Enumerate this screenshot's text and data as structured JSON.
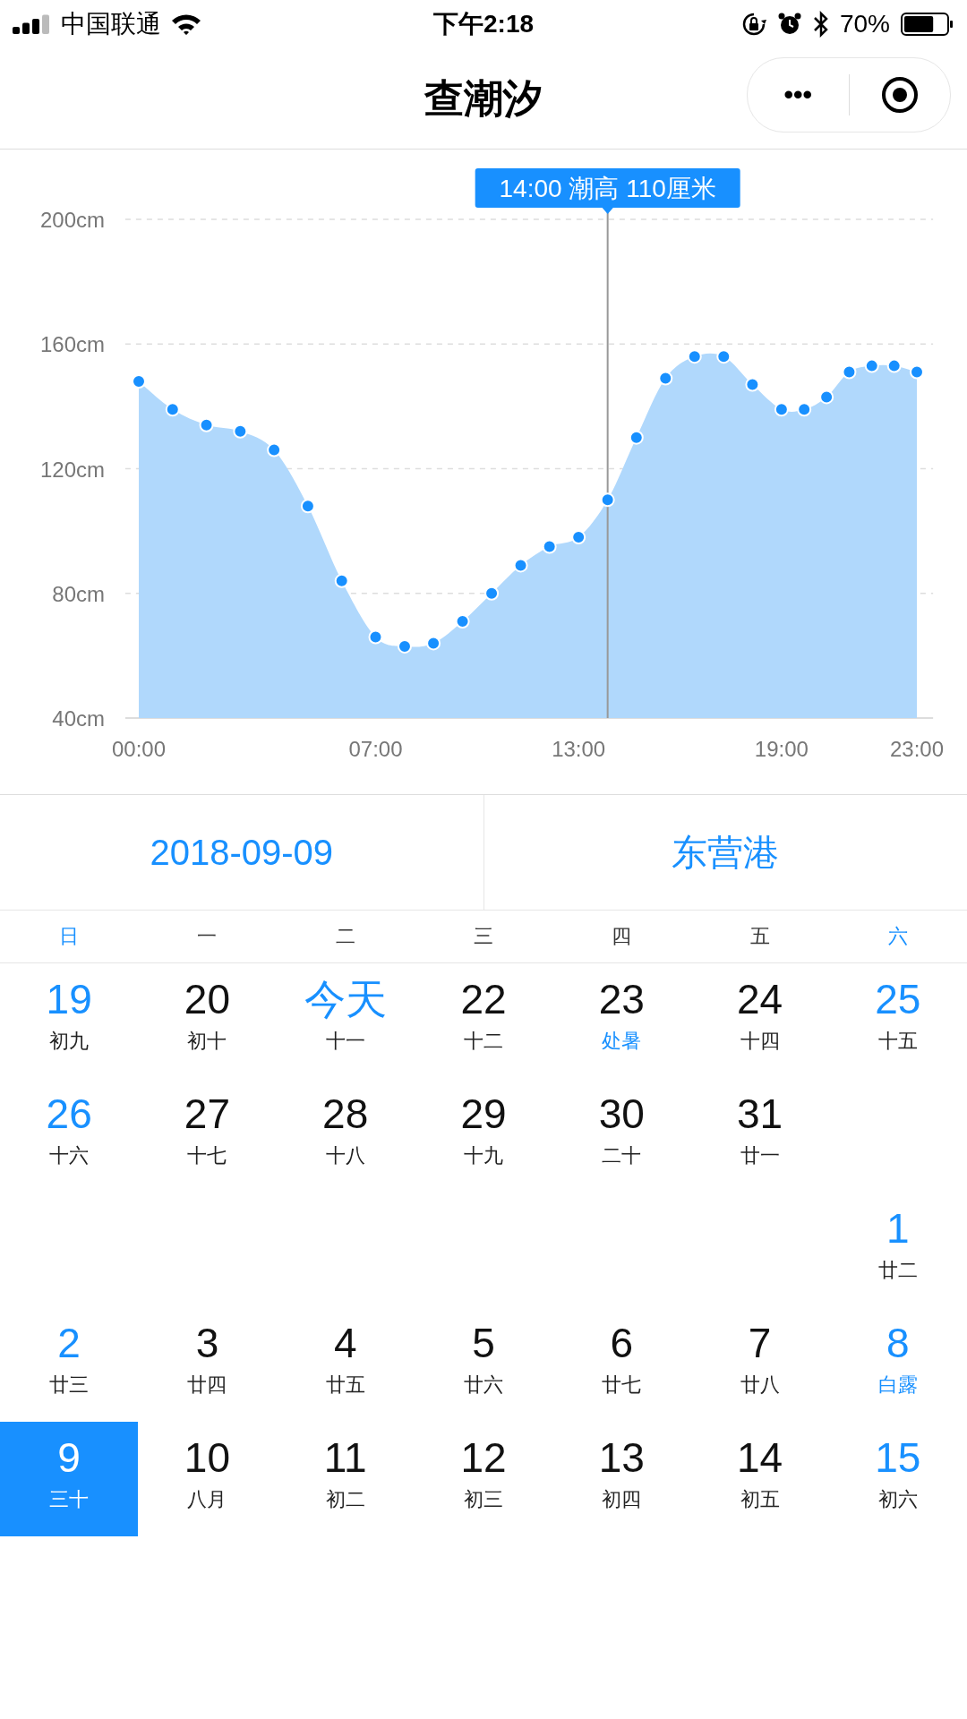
{
  "status_bar": {
    "carrier": "中国联通",
    "time": "下午2:18",
    "battery": "70%"
  },
  "nav_bar": {
    "title": "查潮汐",
    "more": "•••"
  },
  "tide_chart": {
    "chart_data": {
      "type": "area",
      "x": [
        0,
        1,
        2,
        3,
        4,
        5,
        6,
        7,
        7.86,
        8.71,
        9.57,
        10.43,
        11.29,
        12.14,
        13,
        13.86,
        14.71,
        15.57,
        16.43,
        17.29,
        18.14,
        19,
        19.67,
        20.33,
        21,
        21.67,
        22.33,
        23
      ],
      "xlim": [
        -0.4,
        23.48
      ],
      "grid": true,
      "series": [
        {
          "color": "#1890ff",
          "values": [
            148,
            139,
            134,
            132,
            126,
            108,
            84,
            66,
            63,
            64,
            71,
            80,
            89,
            95,
            98,
            110,
            130,
            149,
            156,
            156,
            147,
            139,
            139,
            143,
            151,
            153,
            153,
            151
          ]
        }
      ],
      "ylim": [
        40,
        200
      ],
      "yticks": [
        {
          "value": 40,
          "label": "40cm"
        },
        {
          "value": 80,
          "label": "80cm"
        },
        {
          "value": 120,
          "label": "120cm"
        },
        {
          "value": 160,
          "label": "160cm"
        },
        {
          "value": 200,
          "label": "200cm"
        }
      ],
      "xticks": [
        {
          "value": 0,
          "label": "00:00"
        },
        {
          "value": 7,
          "label": "07:00"
        },
        {
          "value": 13,
          "label": "13:00"
        },
        {
          "value": 19,
          "label": "19:00"
        },
        {
          "value": 23,
          "label": "23:00"
        }
      ],
      "annotations": [
        {
          "x": 13.86,
          "text": "14:00 潮高 110厘米"
        }
      ]
    }
  },
  "selectors": {
    "date": "2018-09-09",
    "port": "东营港"
  },
  "calendar": {
    "weekdays": [
      {
        "label": "日",
        "weekend": true
      },
      {
        "label": "一",
        "weekend": false
      },
      {
        "label": "二",
        "weekend": false
      },
      {
        "label": "三",
        "weekend": false
      },
      {
        "label": "四",
        "weekend": false
      },
      {
        "label": "五",
        "weekend": false
      },
      {
        "label": "六",
        "weekend": true
      }
    ],
    "weeks": [
      {
        "align_end": false,
        "days": [
          {
            "day": "19",
            "lunar": "初九",
            "highlight": true,
            "term": false,
            "selected": false
          },
          {
            "day": "20",
            "lunar": "初十",
            "highlight": false,
            "term": false,
            "selected": false
          },
          {
            "day": "今天",
            "lunar": "十一",
            "highlight": true,
            "term": false,
            "selected": false
          },
          {
            "day": "22",
            "lunar": "十二",
            "highlight": false,
            "term": false,
            "selected": false
          },
          {
            "day": "23",
            "lunar": "处暑",
            "highlight": false,
            "term": true,
            "selected": false
          },
          {
            "day": "24",
            "lunar": "十四",
            "highlight": false,
            "term": false,
            "selected": false
          },
          {
            "day": "25",
            "lunar": "十五",
            "highlight": true,
            "term": false,
            "selected": false
          }
        ]
      },
      {
        "align_end": false,
        "days": [
          {
            "day": "26",
            "lunar": "十六",
            "highlight": true,
            "term": false,
            "selected": false
          },
          {
            "day": "27",
            "lunar": "十七",
            "highlight": false,
            "term": false,
            "selected": false
          },
          {
            "day": "28",
            "lunar": "十八",
            "highlight": false,
            "term": false,
            "selected": false
          },
          {
            "day": "29",
            "lunar": "十九",
            "highlight": false,
            "term": false,
            "selected": false
          },
          {
            "day": "30",
            "lunar": "二十",
            "highlight": false,
            "term": false,
            "selected": false
          },
          {
            "day": "31",
            "lunar": "廿一",
            "highlight": false,
            "term": false,
            "selected": false
          }
        ]
      },
      {
        "align_end": true,
        "days": [
          {
            "day": "1",
            "lunar": "廿二",
            "highlight": true,
            "term": false,
            "selected": false
          }
        ]
      },
      {
        "align_end": false,
        "days": [
          {
            "day": "2",
            "lunar": "廿三",
            "highlight": true,
            "term": false,
            "selected": false
          },
          {
            "day": "3",
            "lunar": "廿四",
            "highlight": false,
            "term": false,
            "selected": false
          },
          {
            "day": "4",
            "lunar": "廿五",
            "highlight": false,
            "term": false,
            "selected": false
          },
          {
            "day": "5",
            "lunar": "廿六",
            "highlight": false,
            "term": false,
            "selected": false
          },
          {
            "day": "6",
            "lunar": "廿七",
            "highlight": false,
            "term": false,
            "selected": false
          },
          {
            "day": "7",
            "lunar": "廿八",
            "highlight": false,
            "term": false,
            "selected": false
          },
          {
            "day": "8",
            "lunar": "白露",
            "highlight": true,
            "term": true,
            "selected": false
          }
        ]
      },
      {
        "align_end": false,
        "days": [
          {
            "day": "9",
            "lunar": "三十",
            "highlight": true,
            "term": false,
            "selected": true
          },
          {
            "day": "10",
            "lunar": "八月",
            "highlight": false,
            "term": false,
            "selected": false
          },
          {
            "day": "11",
            "lunar": "初二",
            "highlight": false,
            "term": false,
            "selected": false
          },
          {
            "day": "12",
            "lunar": "初三",
            "highlight": false,
            "term": false,
            "selected": false
          },
          {
            "day": "13",
            "lunar": "初四",
            "highlight": false,
            "term": false,
            "selected": false
          },
          {
            "day": "14",
            "lunar": "初五",
            "highlight": false,
            "term": false,
            "selected": false
          },
          {
            "day": "15",
            "lunar": "初六",
            "highlight": true,
            "term": false,
            "selected": false
          }
        ]
      }
    ]
  }
}
